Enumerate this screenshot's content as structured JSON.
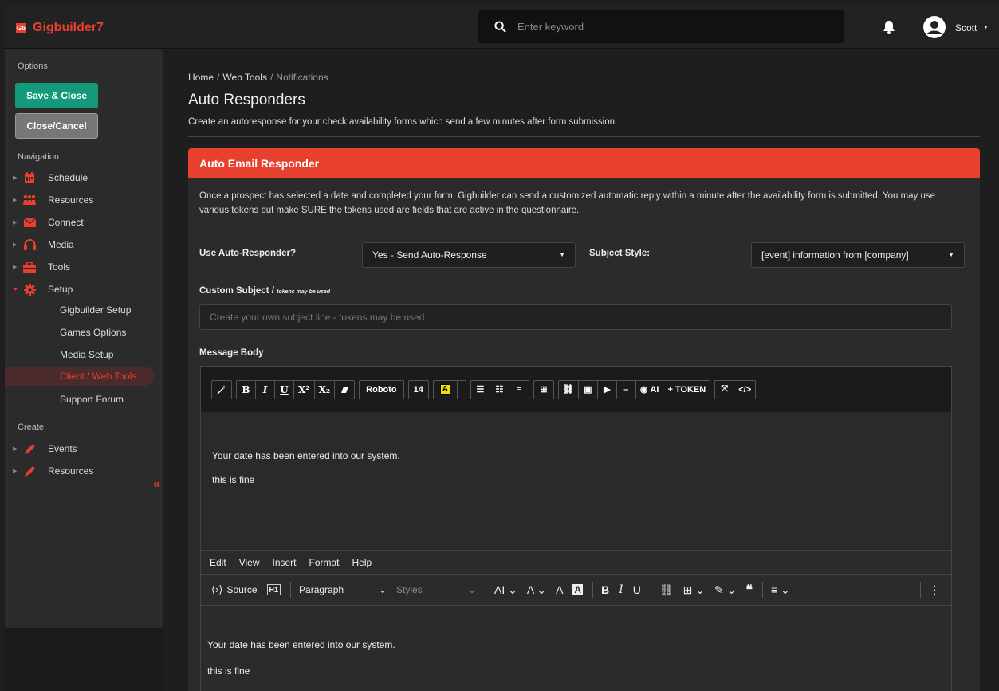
{
  "app": {
    "brand_logo": "Gb",
    "brand_name": "Gigbuilder7",
    "search_placeholder": "Enter keyword",
    "user_name": "Scott"
  },
  "sidebar": {
    "options_label": "Options",
    "save_label": "Save & Close",
    "cancel_label": "Close/Cancel",
    "navigation_label": "Navigation",
    "nav_items": [
      {
        "label": "Schedule",
        "icon": "calendar-icon"
      },
      {
        "label": "Resources",
        "icon": "people-icon"
      },
      {
        "label": "Connect",
        "icon": "envelope-icon"
      },
      {
        "label": "Media",
        "icon": "headphones-icon"
      },
      {
        "label": "Tools",
        "icon": "toolbox-icon"
      },
      {
        "label": "Setup",
        "icon": "gear-icon"
      }
    ],
    "setup_sub_items": [
      "Gigbuilder Setup",
      "Games Options",
      "Media Setup",
      "Client / Web Tools",
      "Support Forum"
    ],
    "create_label": "Create",
    "create_items": [
      "Events",
      "Resources"
    ],
    "collapse_glyph": "«"
  },
  "breadcrumb": {
    "home": "Home",
    "section": "Web Tools",
    "current": "Notifications"
  },
  "page": {
    "title": "Auto Responders",
    "description": "Create an autoresponse for your check availability forms which send a few minutes after form submission."
  },
  "card": {
    "title": "Auto Email Responder",
    "intro": "Once a prospect has selected a date and completed your form, Gigbuilder can send a customized automatic reply within a minute after the availability form is submitted. You may use various tokens but make SURE the tokens used are fields that are active in the questionnaire.",
    "use_label": "Use Auto-Responder?",
    "use_value": "Yes - Send Auto-Response",
    "subject_style_label": "Subject Style:",
    "subject_style_value": "[event] information from [company]",
    "custom_subject_label": "Custom Subject /",
    "custom_subject_note": "tokens may be used",
    "custom_subject_placeholder": "Create your own subject line - tokens may be used",
    "message_body_label": "Message Body"
  },
  "editor1": {
    "toolbar": {
      "bold": "B",
      "italic": "I",
      "underline": "U",
      "superscript": "X²",
      "subscript": "X₂",
      "font": "Roboto",
      "size": "14",
      "ai": "AI",
      "token": "+ TOKEN",
      "code": "</>"
    },
    "lines": [
      "Your date has been entered into our system.",
      "this is fine"
    ]
  },
  "editor2": {
    "menu": [
      "Edit",
      "View",
      "Insert",
      "Format",
      "Help"
    ],
    "source_label": "Source",
    "block_label": "Paragraph",
    "styles_label": "Styles",
    "lines": [
      "Your date has been entered into our system.",
      "this is fine"
    ]
  },
  "colors": {
    "accent": "#e8402f",
    "save": "#149a7b"
  }
}
